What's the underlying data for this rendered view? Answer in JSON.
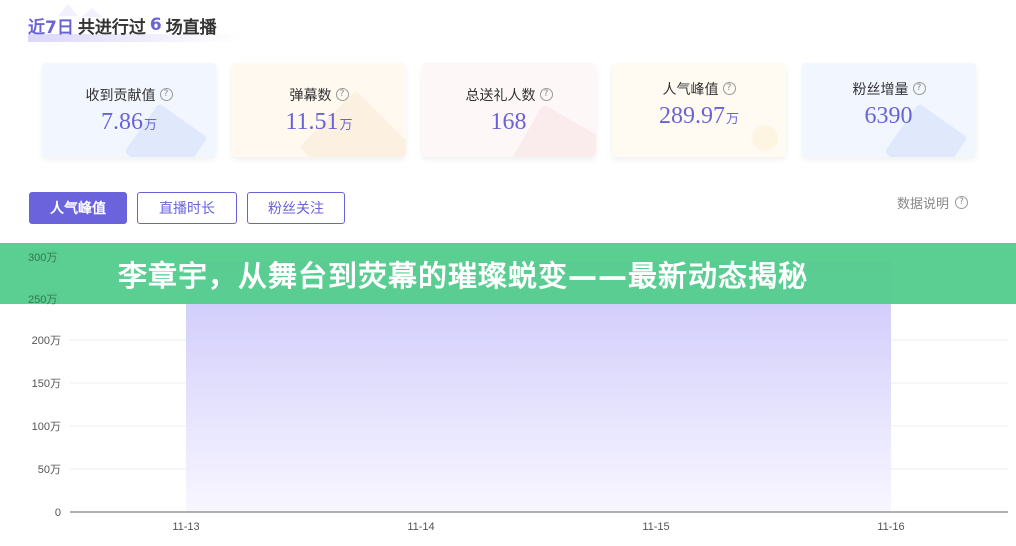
{
  "header": {
    "prefix": "近7日",
    "middle": "共进行过",
    "count": "6",
    "suffix": "场直播"
  },
  "cards": [
    {
      "label": "收到贡献值",
      "value": "7.86",
      "unit": "万",
      "help_icon": "question-circle-icon"
    },
    {
      "label": "弹幕数",
      "value": "11.51",
      "unit": "万",
      "help_icon": "question-circle-icon"
    },
    {
      "label": "总送礼人数",
      "value": "168",
      "unit": "",
      "help_icon": "question-circle-icon"
    },
    {
      "label": "人气峰值",
      "value": "289.97",
      "unit": "万",
      "help_icon": "question-circle-icon"
    },
    {
      "label": "粉丝增量",
      "value": "6390",
      "unit": "",
      "help_icon": "question-circle-icon"
    }
  ],
  "tabs": [
    {
      "label": "人气峰值",
      "active": true
    },
    {
      "label": "直播时长",
      "active": false
    },
    {
      "label": "粉丝关注",
      "active": false
    }
  ],
  "data_explain": {
    "label": "数据说明",
    "icon": "question-circle-icon"
  },
  "banner": {
    "text": "李章宇，从舞台到荧幕的璀璨蜕变——最新动态揭秘"
  },
  "colors": {
    "accent": "#6b63dc",
    "banner": "#56cc8e",
    "area_top": "#cbc6fb",
    "area_bottom": "#f7f6ff"
  },
  "chart_data": {
    "type": "area",
    "title": "",
    "xlabel": "",
    "ylabel": "",
    "categories": [
      "11-13",
      "11-14",
      "11-15",
      "11-16"
    ],
    "series": [
      {
        "name": "人气峰值",
        "values": [
          2899700,
          2899700,
          2899700,
          2899700
        ]
      }
    ],
    "ylim": [
      0,
      3000000
    ],
    "yticks": [
      0,
      500000,
      1000000,
      1500000,
      2000000,
      2500000,
      3000000
    ],
    "ytick_labels": [
      "0",
      "50万",
      "100万",
      "150万",
      "200万",
      "250万",
      "300万"
    ],
    "grid": true,
    "legend": "none"
  }
}
